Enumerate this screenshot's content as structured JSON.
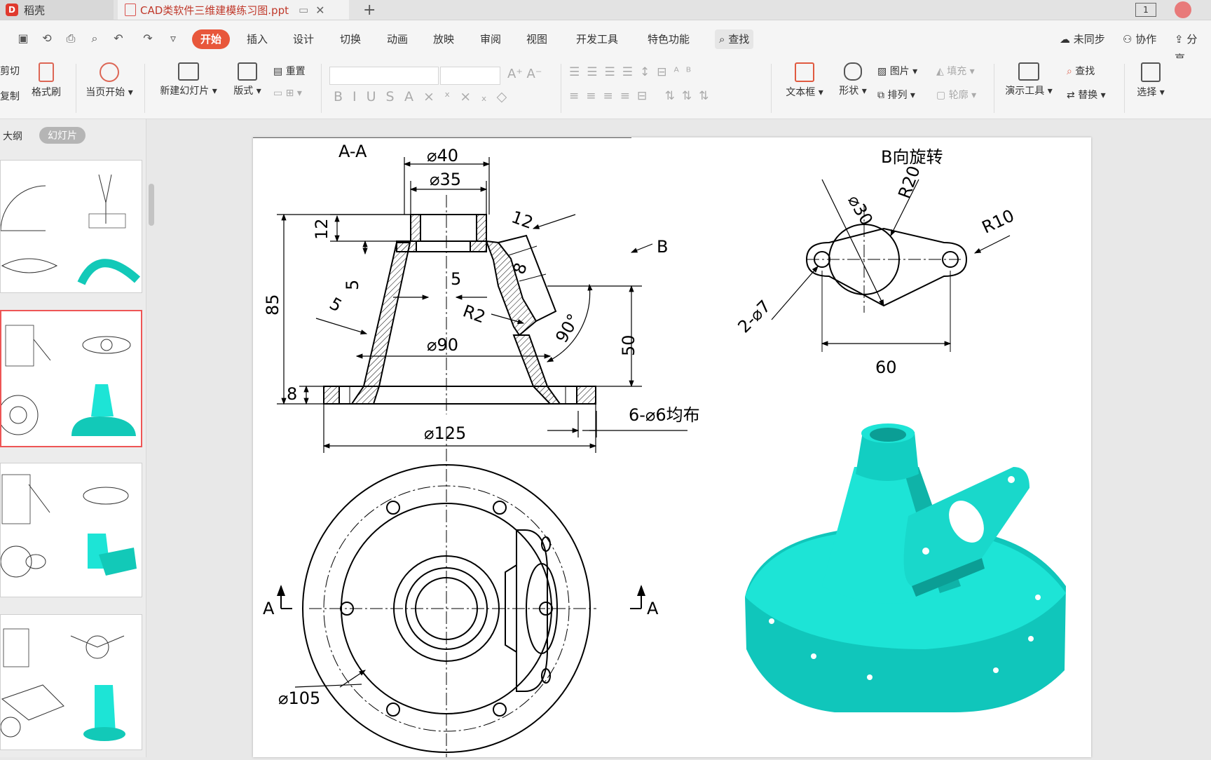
{
  "tabs": {
    "home_label": "稻壳",
    "doc_label": "CAD类软件三维建模练习图.ppt",
    "new_tab": "+"
  },
  "menu": {
    "items": [
      "开始",
      "插入",
      "设计",
      "切换",
      "动画",
      "放映",
      "审阅",
      "视图",
      "开发工具",
      "特色功能"
    ],
    "search": "查找",
    "right": [
      "未同步",
      "协作",
      "分享"
    ]
  },
  "ribbon": {
    "cut": "剪切",
    "copy": "复制",
    "format_painter": "格式刷",
    "play_from_current": "当页开始",
    "new_slide": "新建幻灯片",
    "layout": "版式",
    "reset": "重置",
    "text_box": "文本框",
    "shape": "形状",
    "picture": "图片",
    "arrange": "排列",
    "fill": "填充",
    "outline": "轮廓",
    "present_tools": "演示工具",
    "find": "查找",
    "replace": "替换",
    "select": "选择"
  },
  "sidebar": {
    "outline_tab": "大纲",
    "slides_tab": "幻灯片"
  },
  "slide": {
    "section_title": "A-A",
    "view_title": "B向旋转",
    "dims": {
      "d40": "⌀40",
      "d35": "⌀35",
      "d90": "⌀90",
      "d125": "⌀125",
      "d105": "⌀105",
      "d30": "⌀30",
      "h12": "12",
      "h85": "85",
      "h5a": "5",
      "h5b": "5",
      "h5c": "5",
      "h8": "8",
      "h8b": "8",
      "h50": "50",
      "t12": "12",
      "r2": "R2",
      "r20": "R20",
      "r10": "R10",
      "a90": "90°",
      "w60": "60",
      "holes2": "2-⌀7",
      "holes6": "6-⌀6均布",
      "arrow_b": "B",
      "sec_a_left": "A",
      "sec_a_right": "A"
    }
  },
  "colors": {
    "accent": "#e8573b",
    "model": "#1de4d6",
    "model_dark": "#0fb3a8"
  }
}
